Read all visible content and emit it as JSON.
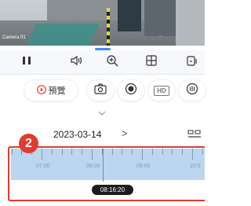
{
  "camera": {
    "name": "Camera 01",
    "overlay_text": "..."
  },
  "toolbar": {
    "items": [
      "pause-icon",
      "speaker-icon",
      "zoom-icon",
      "layout-grid-icon",
      "rotate-icon"
    ]
  },
  "controls": {
    "preview_label": "預覽",
    "hd_label": "HD",
    "items": [
      "camera-snapshot-icon",
      "record-icon",
      "hd-icon",
      "ptz-icon"
    ]
  },
  "date": {
    "value": "2023-03-14",
    "next_label": ">"
  },
  "timeline": {
    "hours": [
      "07:00",
      "08:00",
      "09:00",
      "10:0"
    ],
    "current_time": "08:16:20"
  },
  "annotation": {
    "badge": "2"
  },
  "colors": {
    "accent": "#3a8ef6",
    "timeline_bg": "#bcd6ef",
    "highlight": "#e23b2e"
  }
}
